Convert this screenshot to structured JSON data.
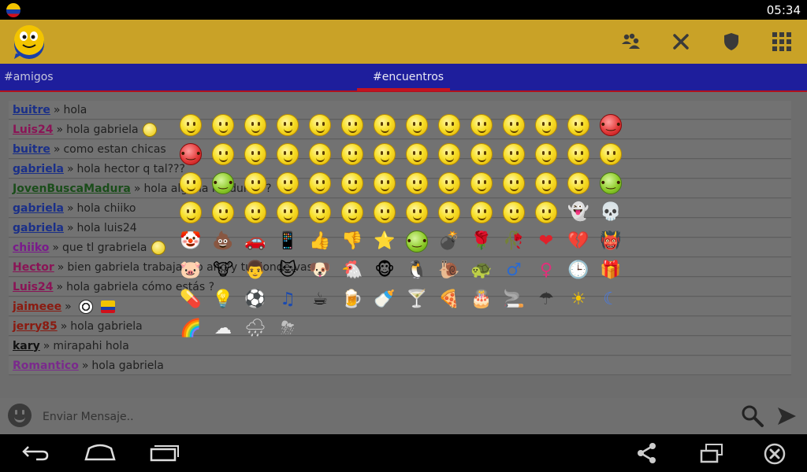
{
  "status_bar": {
    "time": "05:34"
  },
  "action_bar": {
    "icons": [
      "people-icon",
      "close-icon",
      "shield-icon",
      "grid-icon"
    ]
  },
  "tabs": [
    {
      "label": "#amigos",
      "active": false
    },
    {
      "label": "#encuentros",
      "active": true
    }
  ],
  "chat": [
    {
      "nick": "buitre",
      "nick_color": "#1a2f88",
      "text": "hola",
      "icons": []
    },
    {
      "nick": "Luis24",
      "nick_color": "#8a1456",
      "text": "hola gabriela",
      "icons": [
        "smile"
      ]
    },
    {
      "nick": "buitre",
      "nick_color": "#1a2f88",
      "text": "como estan chicas",
      "icons": []
    },
    {
      "nick": "gabriela",
      "nick_color": "#1a2f88",
      "text": "hola hector q tal???",
      "icons": []
    },
    {
      "nick": "JovenBuscaMadura",
      "nick_color": "#1a4d1a",
      "text": "hola alguna madurita ?",
      "icons": []
    },
    {
      "nick": "gabriela",
      "nick_color": "#1a2f88",
      "text": "hola chiiko",
      "icons": []
    },
    {
      "nick": "gabriela",
      "nick_color": "#1a2f88",
      "text": "hola luis24",
      "icons": []
    },
    {
      "nick": "chiiko",
      "nick_color": "#7a1a8c",
      "text": "que tl grabriela",
      "icons": [
        "smile"
      ]
    },
    {
      "nick": "Hector",
      "nick_color": "#8a1456",
      "text": "bien gabriela trabajando and y tu donde vas",
      "icons": []
    },
    {
      "nick": "Luis24",
      "nick_color": "#8a1456",
      "text": "hola gabriela cómo estás ?",
      "icons": []
    },
    {
      "nick": "jaimeee",
      "nick_color": "#8a1a10",
      "text": "",
      "icons": [
        "soccer",
        "colombia-flag"
      ]
    },
    {
      "nick": "jerry85",
      "nick_color": "#8a1a10",
      "text": "hola gabriela",
      "icons": []
    },
    {
      "nick": "kary",
      "nick_color": "#111111",
      "text": "mirapahi hola",
      "icons": []
    },
    {
      "nick": "Romantico",
      "nick_color": "#7a2a8c",
      "text": "hola gabriela",
      "icons": []
    }
  ],
  "emoji_picker": {
    "rows": [
      [
        "face",
        "face",
        "face",
        "face",
        "face",
        "face",
        "face",
        "face",
        "face",
        "face",
        "face",
        "face",
        "face",
        "red"
      ],
      [
        "red",
        "face",
        "face",
        "face",
        "face",
        "face",
        "face",
        "face",
        "face",
        "face",
        "face",
        "face",
        "face",
        "face"
      ],
      [
        "face",
        "green",
        "face",
        "face",
        "face",
        "face",
        "face",
        "face",
        "face",
        "face",
        "face",
        "face",
        "face",
        "green"
      ],
      [
        "face",
        "face",
        "face",
        "face",
        "face",
        "face",
        "face",
        "face",
        "face",
        "face",
        "face",
        "face",
        "ghost",
        "skull"
      ],
      [
        "clown",
        "poop",
        "car",
        "phone",
        "thumbs-up",
        "thumbs-down",
        "star",
        "green-face",
        "bomb",
        "rose",
        "wilted-rose",
        "heart",
        "broken-heart",
        "devil-mask"
      ],
      [
        "pig",
        "cow",
        "chef",
        "cat",
        "dog",
        "chicken",
        "monkey",
        "penguin",
        "snail",
        "turtle",
        "male",
        "female",
        "clock",
        "gift"
      ],
      [
        "pill",
        "lightbulb",
        "soccer-ball",
        "music-note",
        "coffee",
        "beer",
        "bottle",
        "cocktail",
        "pizza",
        "cake",
        "cigarette",
        "umbrella",
        "sun",
        "moon"
      ],
      [
        "rainbow",
        "cloud",
        "rain-cloud",
        "storm-cloud"
      ]
    ],
    "glyphs": {
      "ghost": "👻",
      "skull": "💀",
      "clown": "🤡",
      "poop": "💩",
      "car": "🚗",
      "phone": "📱",
      "thumbs-up": "👍",
      "thumbs-down": "👎",
      "star": "⭐",
      "bomb": "💣",
      "rose": "🌹",
      "wilted-rose": "🥀",
      "heart": "❤",
      "broken-heart": "💔",
      "devil-mask": "👹",
      "pig": "🐷",
      "cow": "🐮",
      "chef": "👨",
      "cat": "🐱",
      "dog": "🐶",
      "chicken": "🐔",
      "monkey": "🐵",
      "penguin": "🐧",
      "snail": "🐌",
      "turtle": "🐢",
      "male": "♂",
      "female": "♀",
      "clock": "🕒",
      "gift": "🎁",
      "pill": "💊",
      "lightbulb": "💡",
      "soccer-ball": "⚽",
      "music-note": "♫",
      "coffee": "☕",
      "beer": "🍺",
      "bottle": "🍼",
      "cocktail": "🍸",
      "pizza": "🍕",
      "cake": "🎂",
      "cigarette": "🚬",
      "umbrella": "☂",
      "sun": "☀",
      "moon": "☾",
      "rainbow": "🌈",
      "cloud": "☁",
      "rain-cloud": "🌧",
      "storm-cloud": "⛈"
    },
    "glyph_colors": {
      "ghost": "#e8e8e8",
      "skull": "#e8e8e8",
      "heart": "#e0202a",
      "broken-heart": "#c01018",
      "male": "#2a6ad0",
      "female": "#e0307a",
      "umbrella": "#333333",
      "sun": "#f5c400",
      "moon": "#4a7ae0",
      "music-note": "#1a4ab0",
      "cloud": "#f0f0f0",
      "rain-cloud": "#d0d0d0",
      "storm-cloud": "#c0c0c0"
    }
  },
  "input": {
    "placeholder": "Enviar Mensaje.."
  },
  "nav": [
    "back-icon",
    "home-icon",
    "recent-apps-icon",
    "share-icon",
    "window-icon",
    "close-circle-icon"
  ]
}
